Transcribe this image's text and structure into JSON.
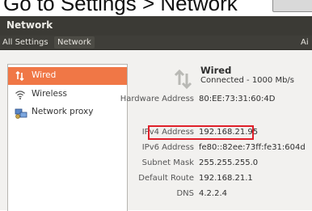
{
  "caption": {
    "text": "Go to Settings > Network"
  },
  "window": {
    "title": "Network"
  },
  "nav": {
    "all_settings": "All Settings",
    "current": "Network",
    "right_truncated": "Ai"
  },
  "sidebar": {
    "items": [
      {
        "label": "Wired",
        "icon": "wired-network-icon",
        "selected": true
      },
      {
        "label": "Wireless",
        "icon": "wifi-icon",
        "selected": false
      },
      {
        "label": "Network proxy",
        "icon": "network-proxy-icon",
        "selected": false
      }
    ]
  },
  "detail": {
    "title": "Wired",
    "status": "Connected - 1000 Mb/s",
    "rows": [
      {
        "key": "Hardware Address",
        "value": "80:EE:73:31:60:4D"
      },
      {
        "key": "IPv4 Address",
        "value": "192.168.21.95"
      },
      {
        "key": "IPv6 Address",
        "value": "fe80::82ee:73ff:fe31:604d"
      },
      {
        "key": "Subnet Mask",
        "value": "255.255.255.0"
      },
      {
        "key": "Default Route",
        "value": "192.168.21.1"
      },
      {
        "key": "DNS",
        "value": "4.2.2.4"
      }
    ]
  },
  "colors": {
    "selection": "#f07746",
    "highlight_box": "#e0202a",
    "titlebar": "#3b3a35"
  }
}
